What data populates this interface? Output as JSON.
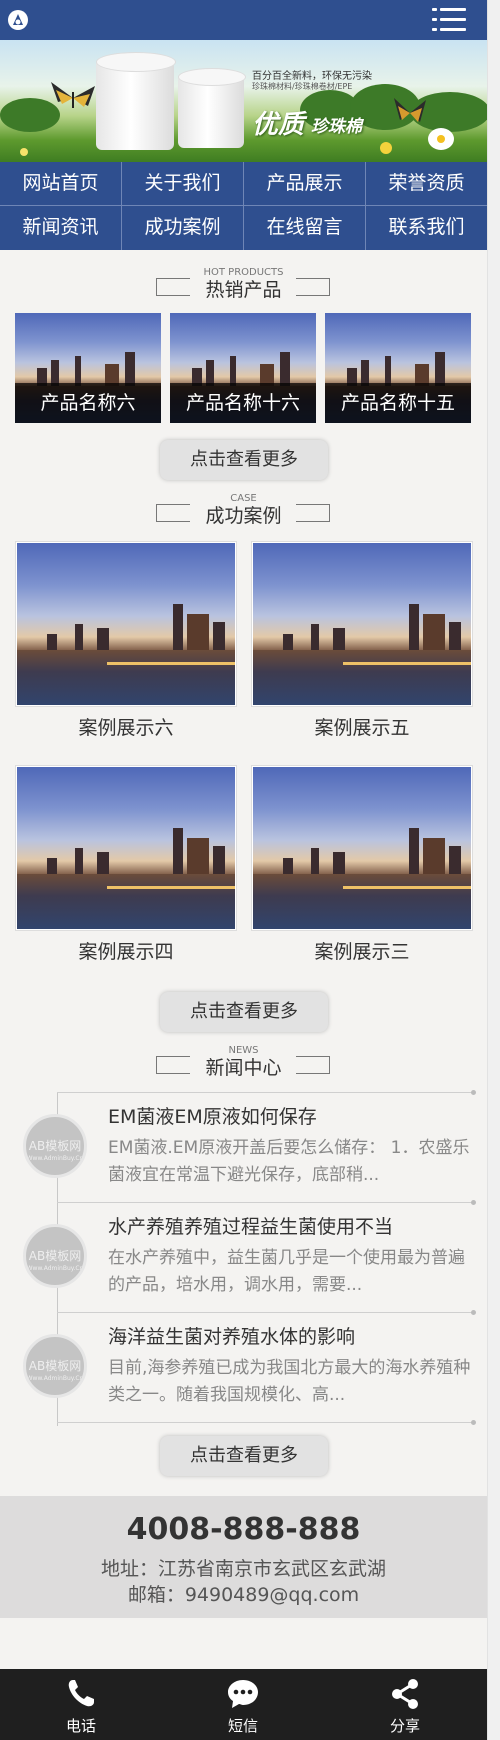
{
  "header": {
    "logo_icon": "logo-icon",
    "menu_icon": "hamburger-menu-icon"
  },
  "banner": {
    "tagline": "百分百全新料，环保无污染",
    "subtagline": "珍珠棉材料/珍珠棉卷材/EPE",
    "headline_big": "优质",
    "headline_small": "珍珠棉"
  },
  "nav": {
    "items": [
      {
        "label": "网站首页"
      },
      {
        "label": "关于我们"
      },
      {
        "label": "产品展示"
      },
      {
        "label": "荣誉资质"
      },
      {
        "label": "新闻资讯"
      },
      {
        "label": "成功案例"
      },
      {
        "label": "在线留言"
      },
      {
        "label": "联系我们"
      }
    ]
  },
  "products": {
    "sub": "HOT PRODUCTS",
    "title": "热销产品",
    "items": [
      {
        "label": "产品名称六"
      },
      {
        "label": "产品名称十六"
      },
      {
        "label": "产品名称十五"
      }
    ],
    "more": "点击查看更多"
  },
  "cases": {
    "sub": "CASE",
    "title": "成功案例",
    "items": [
      {
        "label": "案例展示六"
      },
      {
        "label": "案例展示五"
      },
      {
        "label": "案例展示四"
      },
      {
        "label": "案例展示三"
      }
    ],
    "more": "点击查看更多"
  },
  "news": {
    "sub": "NEWS",
    "title": "新闻中心",
    "avatar_text": "AB模板网",
    "avatar_sub": "Www.AdminBuy.Cn",
    "items": [
      {
        "title": "EM菌液EM原液如何保存",
        "desc": "EM菌液.EM原液开盖后要怎么储存： 1．农盛乐菌液宜在常温下避光保存，底部稍..."
      },
      {
        "title": "水产养殖养殖过程益生菌使用不当",
        "desc": "在水产养殖中，益生菌几乎是一个使用最为普遍的产品，培水用，调水用，需要..."
      },
      {
        "title": "海洋益生菌对养殖水体的影响",
        "desc": "目前,海参养殖已成为我国北方最大的海水养殖种类之一。随着我国规模化、高..."
      }
    ],
    "more": "点击查看更多"
  },
  "contact": {
    "phone": "4008-888-888",
    "address": "地址：江苏省南京市玄武区玄武湖",
    "email": "邮箱：9490489@qq.com"
  },
  "bottombar": {
    "items": [
      {
        "label": "电话",
        "icon": "phone-icon"
      },
      {
        "label": "短信",
        "icon": "message-icon"
      },
      {
        "label": "分享",
        "icon": "share-icon"
      }
    ]
  }
}
